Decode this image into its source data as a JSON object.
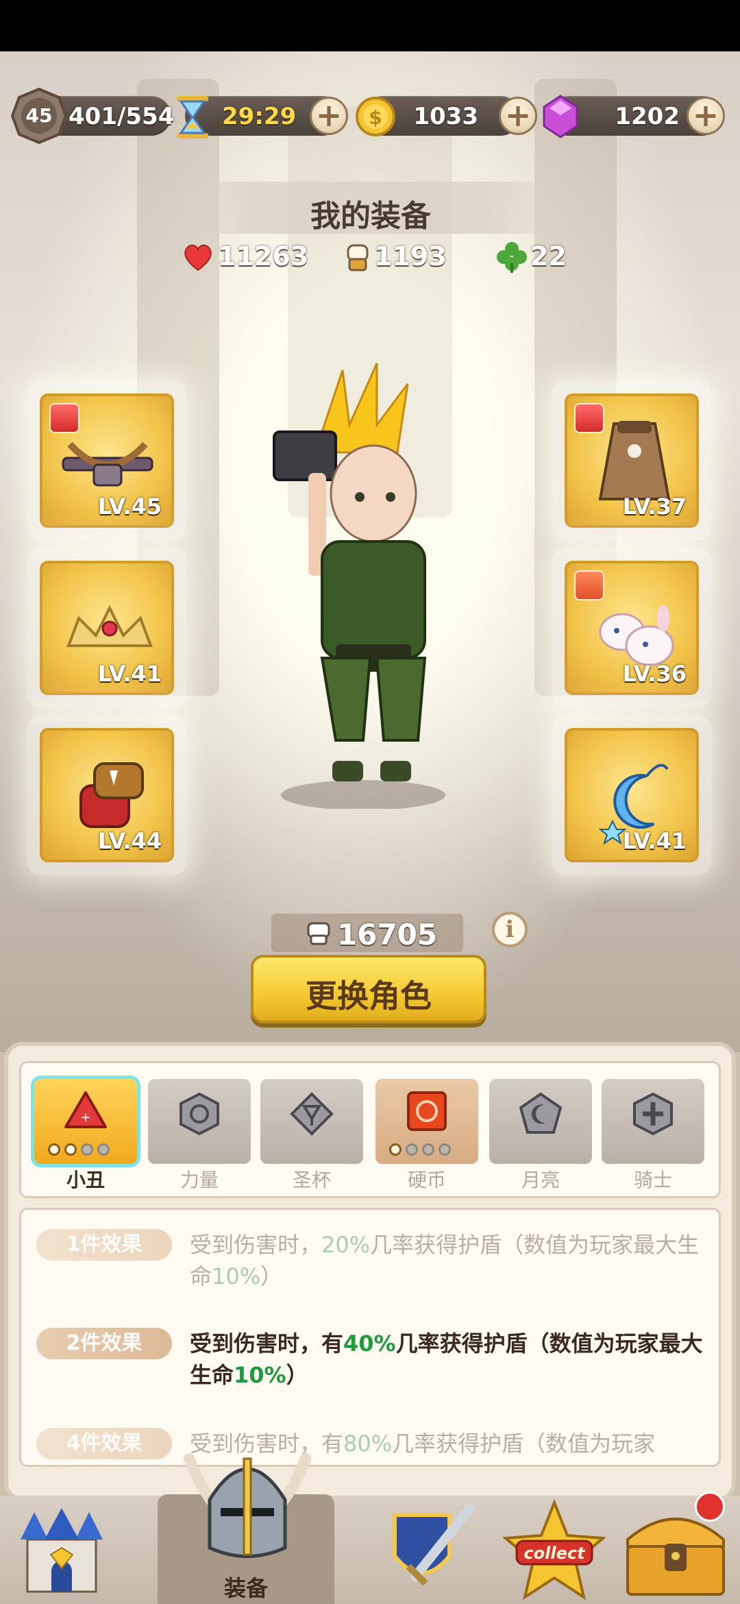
{
  "header": {
    "player_level": "45",
    "exp": "401/554",
    "timer": "29:29",
    "coins": "1033",
    "gems": "1202"
  },
  "equipment_page": {
    "title": "我的装备",
    "stats": {
      "hp": "11263",
      "attack": "1193",
      "luck": "22"
    },
    "slots_left": [
      {
        "name": "crossbow",
        "level": "LV.45"
      },
      {
        "name": "tiara",
        "level": "LV.41"
      },
      {
        "name": "gauntlet",
        "level": "LV.44"
      }
    ],
    "slots_right": [
      {
        "name": "cloak",
        "level": "LV.37"
      },
      {
        "name": "bunny-slippers",
        "level": "LV.36"
      },
      {
        "name": "moon-pendant",
        "level": "LV.41"
      }
    ],
    "power": "16705",
    "change_role_label": "更换角色"
  },
  "set_tabs": [
    {
      "label": "小丑",
      "selected": true
    },
    {
      "label": "力量"
    },
    {
      "label": "圣杯"
    },
    {
      "label": "硬币"
    },
    {
      "label": "月亮"
    },
    {
      "label": "骑士"
    }
  ],
  "effects": [
    {
      "tag": "1件效果",
      "pre": "受到伤害时，",
      "p1": "20%",
      "mid": "几率获得护盾（数值为玩家最大生命",
      "p2": "10%",
      "post": "）"
    },
    {
      "tag": "2件效果",
      "pre": "受到伤害时，有",
      "p1": "40%",
      "mid": "几率获得护盾（数值为玩家最大生命",
      "p2": "10%",
      "post": "）"
    },
    {
      "tag": "4件效果",
      "pre": "受到伤害时，有",
      "p1": "80%",
      "mid": "几率获得护盾（数值为玩家",
      "p2": "",
      "post": ""
    }
  ],
  "bottom_nav": {
    "active_label": "装备",
    "collect_badge": "collect"
  }
}
